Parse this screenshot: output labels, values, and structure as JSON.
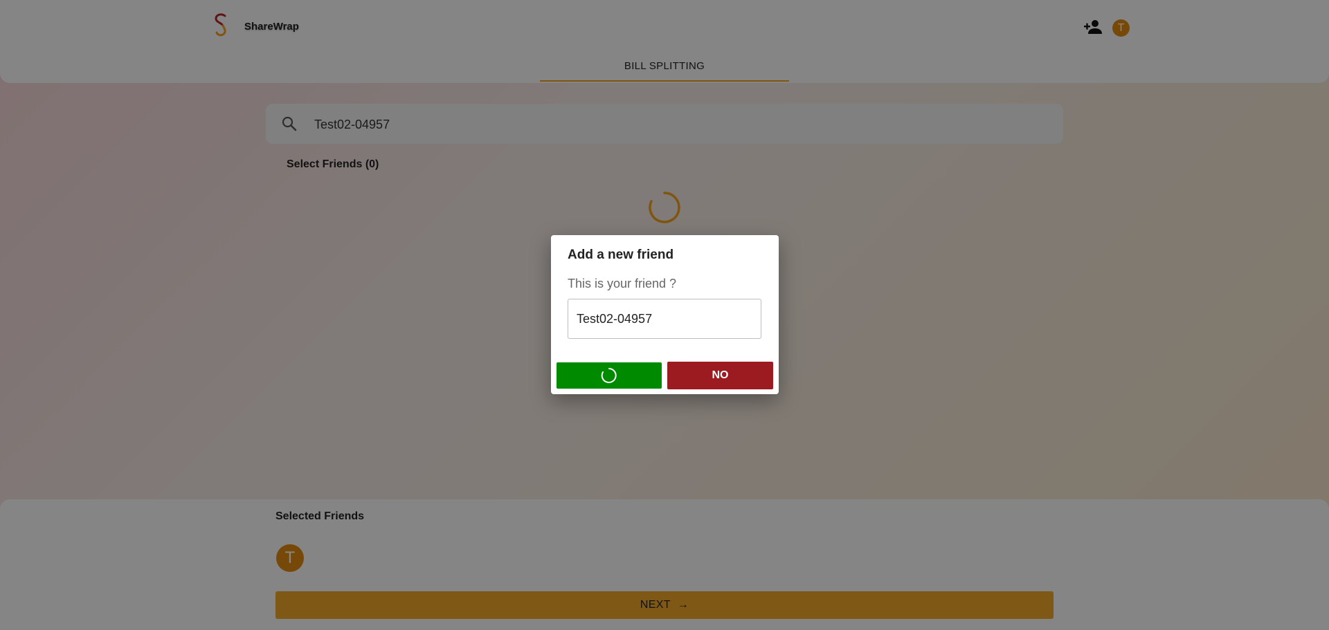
{
  "header": {
    "app_name": "ShareWrap",
    "avatar_letter": "T",
    "tab_label": "BILL SPLITTING",
    "accent_color": "#f0a01e"
  },
  "search": {
    "value": "Test02-04957"
  },
  "friends": {
    "select_label": "Select Friends (0)"
  },
  "bottom": {
    "selected_title": "Selected Friends",
    "avatar_letter": "T",
    "next_label": "NEXT"
  },
  "modal": {
    "title": "Add a new friend",
    "question": "This is your friend ?",
    "input_value": "Test02-04957",
    "no_label": "NO",
    "yes_color": "#008a00",
    "no_color": "#9b1b20"
  },
  "icons": {
    "logo": "sharewrap-logo",
    "add_friend": "person-add-icon",
    "search": "search-icon",
    "loading": "spinner-icon",
    "next_arrow": "arrow-right-icon"
  }
}
